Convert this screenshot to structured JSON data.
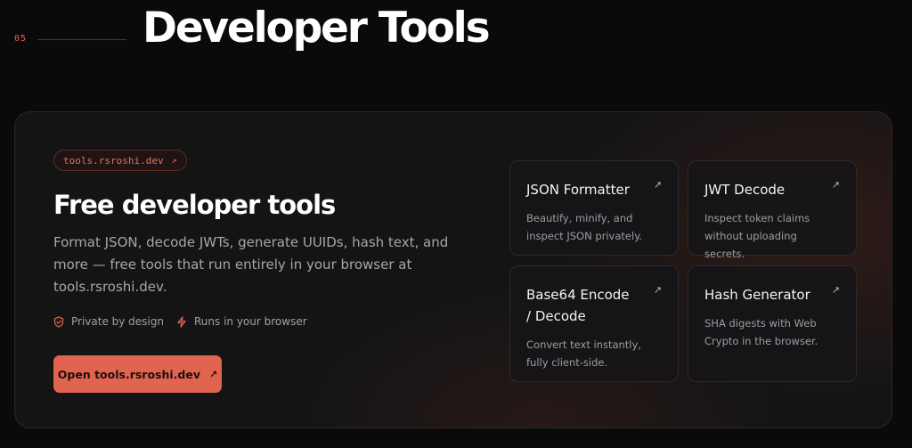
{
  "section": {
    "number": "05",
    "title": "Developer Tools"
  },
  "panel": {
    "pill_label": "tools.rsroshi.dev",
    "headline": "Free developer tools",
    "description": "Format JSON, decode JWTs, generate UUIDs, hash text, and more — free tools that run entirely in your browser at tools.rsroshi.dev.",
    "features": [
      {
        "label": "Private by design",
        "icon": "shield-icon"
      },
      {
        "label": "Runs in your browser",
        "icon": "bolt-icon"
      }
    ],
    "cta_label": "Open tools.rsroshi.dev",
    "arrow_glyph": "↗"
  },
  "tools": [
    {
      "title": "JSON Formatter",
      "description": "Beautify, minify, and inspect JSON privately."
    },
    {
      "title": "JWT Decode",
      "description": "Inspect token claims without uploading secrets."
    },
    {
      "title": "Base64 Encode / Decode",
      "description": "Convert text instantly, fully client-side."
    },
    {
      "title": "Hash Generator",
      "description": "SHA digests with Web Crypto in the browser."
    }
  ],
  "colors": {
    "accent": "#e0644f",
    "background": "#0a0a0b",
    "panel": "#151415"
  }
}
